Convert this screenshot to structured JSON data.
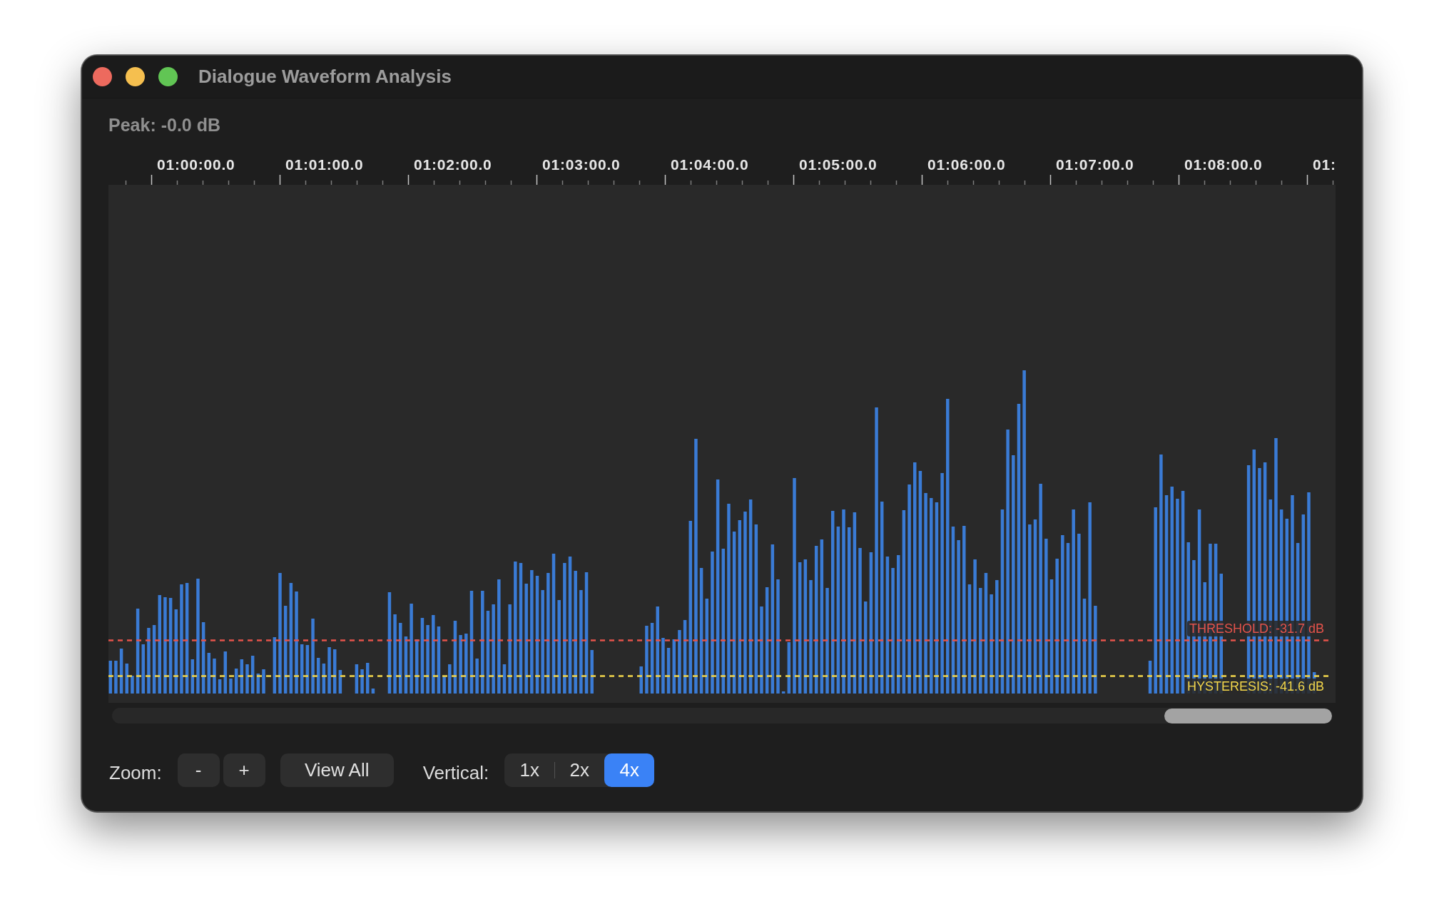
{
  "window": {
    "title": "Dialogue Waveform Analysis"
  },
  "peak": "Peak: -0.0 dB",
  "timeline": {
    "labels": [
      "01:00:00.0",
      "01:01:00.0",
      "01:02:00.0",
      "01:03:00.0",
      "01:04:00.0",
      "01:05:00.0",
      "01:06:00.0",
      "01:07:00.0",
      "01:08:00.0",
      "01:"
    ]
  },
  "waveform": {
    "markers": [
      {
        "kind": "threshold",
        "label": "THRESHOLD: -31.7 dB"
      },
      {
        "kind": "hysteresis",
        "label": "HYSTERESIS: -41.6 dB"
      }
    ]
  },
  "controls": {
    "zoom": {
      "label": "Zoom:",
      "buttons": [
        "-",
        "+"
      ]
    },
    "view_all": "View All",
    "vertical": {
      "label": "Vertical:",
      "options": [
        {
          "label": "1x",
          "selected": false
        },
        {
          "label": "2x",
          "selected": false
        },
        {
          "label": "4x",
          "selected": true
        }
      ]
    }
  }
}
